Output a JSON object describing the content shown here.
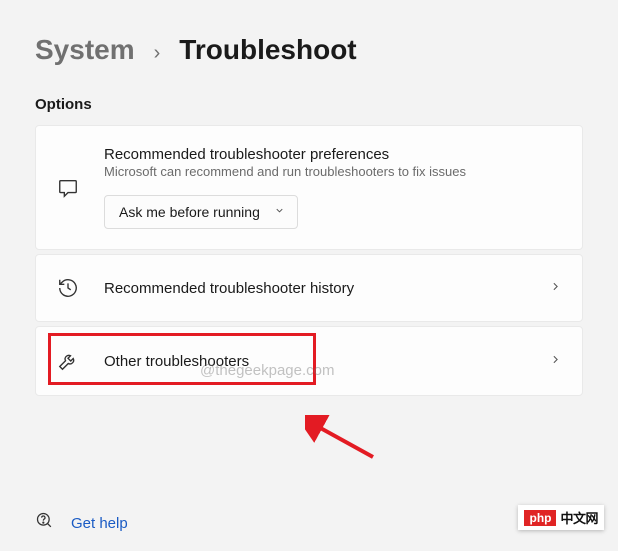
{
  "breadcrumb": {
    "parent": "System",
    "separator": "›",
    "current": "Troubleshoot"
  },
  "section_label": "Options",
  "cards": {
    "prefs": {
      "title": "Recommended troubleshooter preferences",
      "subtitle": "Microsoft can recommend and run troubleshooters to fix issues",
      "dropdown_value": "Ask me before running"
    },
    "history": {
      "title": "Recommended troubleshooter history"
    },
    "other": {
      "title": "Other troubleshooters"
    }
  },
  "watermark": "@thegeekpage.com",
  "footer": {
    "help_link": "Get help"
  },
  "badge": {
    "php": "php",
    "cn": "中文网"
  }
}
